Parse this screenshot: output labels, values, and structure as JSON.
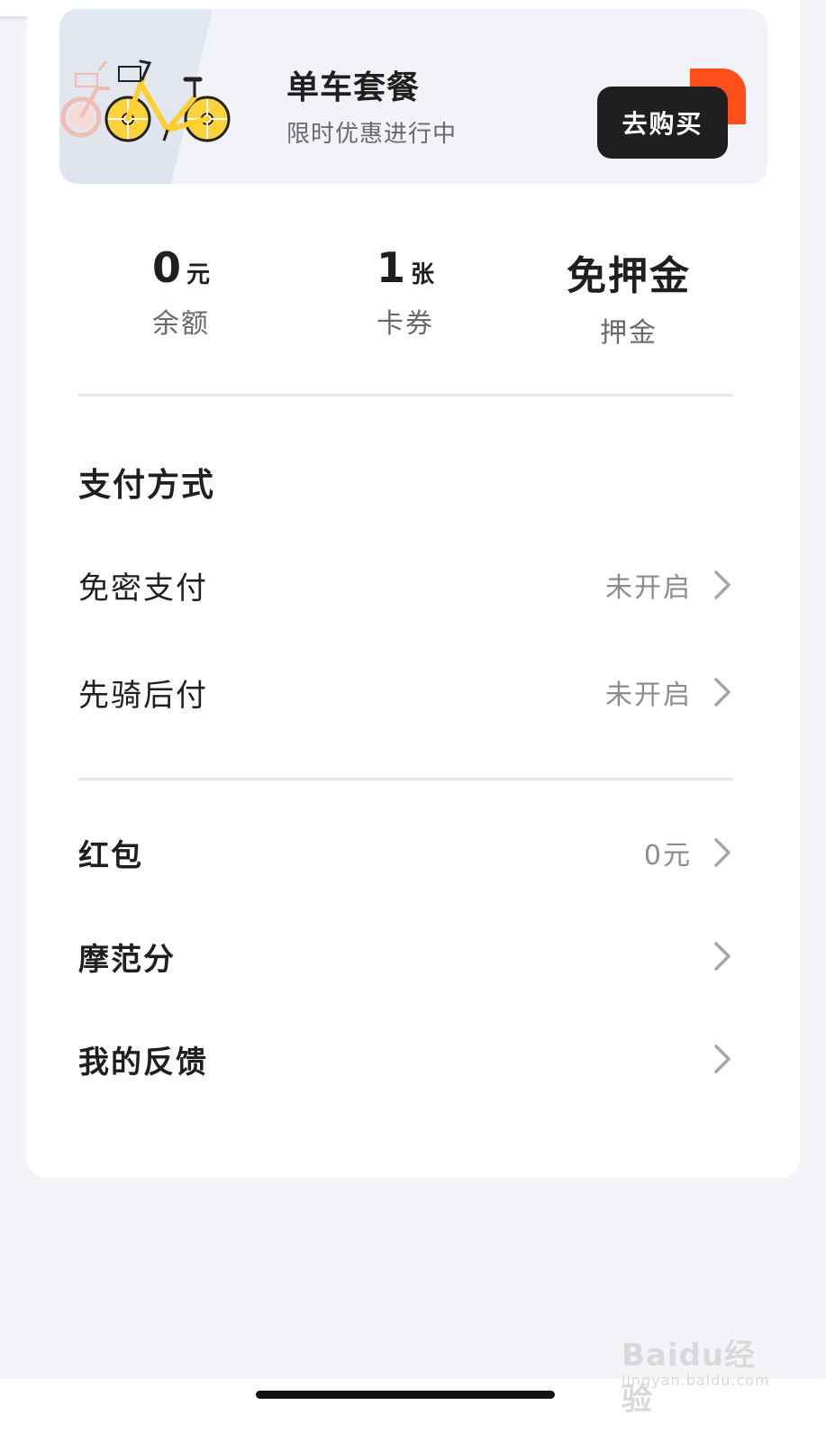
{
  "promo": {
    "title": "单车套餐",
    "subtitle": "限时优惠进行中",
    "buy_label": "去购买"
  },
  "stats": [
    {
      "value": "0",
      "unit": "元",
      "label": "余额"
    },
    {
      "value": "1",
      "unit": "张",
      "label": "卡券"
    },
    {
      "value": "免押金",
      "label": "押金"
    }
  ],
  "payment": {
    "section_title": "支付方式",
    "items": [
      {
        "label": "免密支付",
        "status": "未开启"
      },
      {
        "label": "先骑后付",
        "status": "未开启"
      }
    ]
  },
  "menu": [
    {
      "label": "红包",
      "value": "0元"
    },
    {
      "label": "摩范分"
    },
    {
      "label": "我的反馈"
    }
  ],
  "watermark": {
    "brand": "Baidu经验",
    "site": "jingyan.baidu.com"
  },
  "colors": {
    "accent": "#ff4e1a",
    "button_bg": "#1f1f1f",
    "bike_yellow": "#ffd23c",
    "bike_pink": "#f4b5a9"
  },
  "icons": {
    "chevron": "chevron-right-icon",
    "bike": "bicycle-icon"
  }
}
